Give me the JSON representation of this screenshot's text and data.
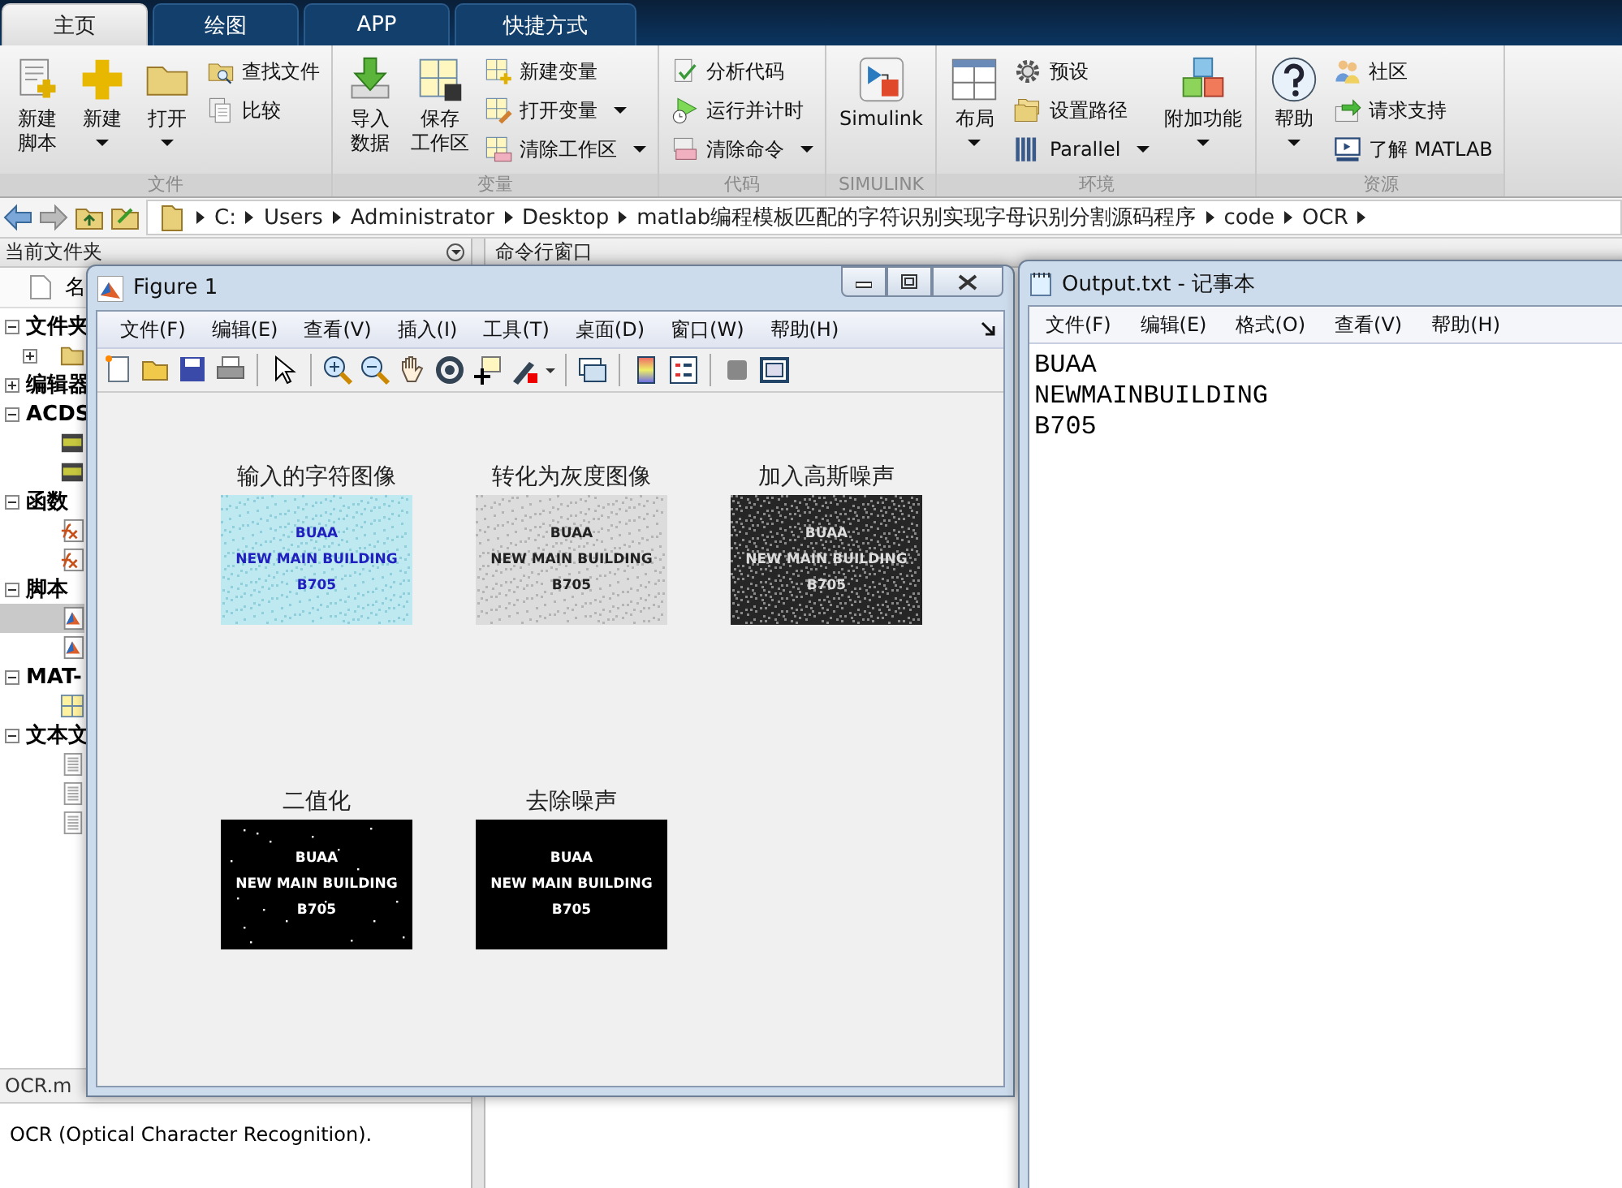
{
  "matlab": {
    "tabs": [
      {
        "label": "主页",
        "selected": true
      },
      {
        "label": "绘图",
        "selected": false
      },
      {
        "label": "APP",
        "selected": false
      },
      {
        "label": "快捷方式",
        "selected": false
      }
    ],
    "ribbon": [
      {
        "label": "文件",
        "columns": [
          {
            "kind": "large",
            "lines": [
              "新建",
              "脚本"
            ],
            "dropdown": false
          },
          {
            "kind": "large",
            "lines": [
              "新建"
            ],
            "dropdown": true
          },
          {
            "kind": "large",
            "lines": [
              "打开"
            ],
            "dropdown": true
          },
          {
            "kind": "stack",
            "items": [
              {
                "label": "查找文件",
                "dropdown": false
              },
              {
                "label": "比较",
                "dropdown": false
              }
            ]
          }
        ]
      },
      {
        "label": "变量",
        "columns": [
          {
            "kind": "large",
            "lines": [
              "导入",
              "数据"
            ],
            "dropdown": false
          },
          {
            "kind": "large",
            "lines": [
              "保存",
              "工作区"
            ],
            "dropdown": false
          },
          {
            "kind": "stack",
            "items": [
              {
                "label": "新建变量",
                "dropdown": false
              },
              {
                "label": "打开变量",
                "dropdown": true
              },
              {
                "label": "清除工作区",
                "dropdown": true
              }
            ]
          }
        ]
      },
      {
        "label": "代码",
        "columns": [
          {
            "kind": "stack",
            "items": [
              {
                "label": "分析代码",
                "dropdown": false
              },
              {
                "label": "运行并计时",
                "dropdown": false
              },
              {
                "label": "清除命令",
                "dropdown": true
              }
            ]
          }
        ]
      },
      {
        "label": "SIMULINK",
        "columns": [
          {
            "kind": "large",
            "lines": [
              "Simulink"
            ],
            "dropdown": false
          }
        ]
      },
      {
        "label": "环境",
        "columns": [
          {
            "kind": "large",
            "lines": [
              "布局"
            ],
            "dropdown": true
          },
          {
            "kind": "stack",
            "items": [
              {
                "label": "预设",
                "dropdown": false
              },
              {
                "label": "设置路径",
                "dropdown": false
              },
              {
                "label": "Parallel",
                "dropdown": true
              }
            ]
          },
          {
            "kind": "large",
            "lines": [
              "附加功能"
            ],
            "dropdown": true
          }
        ]
      },
      {
        "label": "资源",
        "columns": [
          {
            "kind": "large",
            "lines": [
              "帮助"
            ],
            "dropdown": true
          },
          {
            "kind": "stack",
            "items": [
              {
                "label": "社区",
                "dropdown": false
              },
              {
                "label": "请求支持",
                "dropdown": false
              },
              {
                "label": "了解 MATLAB",
                "dropdown": false
              }
            ]
          }
        ]
      }
    ],
    "address": [
      "C:",
      "Users",
      "Administrator",
      "Desktop",
      "matlab编程模板匹配的字符识别实现字母识别分割源码程序",
      "code",
      "OCR"
    ],
    "current_folder": {
      "title": "当前文件夹",
      "column": "名",
      "tree": [
        {
          "label": "文件夹",
          "expanded": true,
          "children": [
            {
              "kind": "folder",
              "expanded": false,
              "selected": false
            }
          ]
        },
        {
          "label": "编辑器",
          "expanded": false
        },
        {
          "label": "ACDS",
          "expanded": true,
          "children": [
            {
              "kind": "jpg",
              "selected": false
            },
            {
              "kind": "jpg",
              "selected": false
            }
          ]
        },
        {
          "label": "函数",
          "expanded": true,
          "children": [
            {
              "kind": "function",
              "selected": false
            },
            {
              "kind": "function",
              "selected": false
            }
          ]
        },
        {
          "label": "脚本",
          "expanded": true,
          "children": [
            {
              "kind": "script",
              "selected": true
            },
            {
              "kind": "script",
              "selected": false
            }
          ]
        },
        {
          "label": "MAT-",
          "expanded": true,
          "children": [
            {
              "kind": "mat",
              "selected": false
            }
          ]
        },
        {
          "label": "文本文",
          "expanded": true,
          "children": [
            {
              "kind": "text",
              "selected": false
            },
            {
              "kind": "text",
              "selected": false
            },
            {
              "kind": "text",
              "selected": false
            }
          ]
        }
      ],
      "file_name": "OCR.m",
      "description": "OCR (Optical Character Recognition)."
    },
    "command_window": {
      "title": "命令行窗口"
    }
  },
  "figure": {
    "title": "Figure 1",
    "menu": [
      "文件(F)",
      "编辑(E)",
      "查看(V)",
      "插入(I)",
      "工具(T)",
      "桌面(D)",
      "窗口(W)",
      "帮助(H)"
    ],
    "images": [
      {
        "title": "输入的字符图像",
        "kind": "color",
        "lines": [
          "BUAA",
          "NEW MAIN BUILDING",
          "B705"
        ]
      },
      {
        "title": "转化为灰度图像",
        "kind": "gray",
        "lines": [
          "BUAA",
          "NEW MAIN BUILDING",
          "B705"
        ]
      },
      {
        "title": "加入高斯噪声",
        "kind": "noisy",
        "lines": [
          "BUAA",
          "NEW MAIN BUILDING",
          "B705"
        ]
      },
      {
        "title": "二值化",
        "kind": "binary",
        "lines": [
          "BUAA",
          "NEW MAIN BUILDING",
          "B705"
        ]
      },
      {
        "title": "去除噪声",
        "kind": "clean",
        "lines": [
          "BUAA",
          "NEW MAIN BUILDING",
          "B705"
        ]
      }
    ]
  },
  "notepad": {
    "title": "Output.txt - 记事本",
    "menu": [
      "文件(F)",
      "编辑(E)",
      "格式(O)",
      "查看(V)",
      "帮助(H)"
    ],
    "lines": [
      "BUAA",
      "NEWMAINBUILDING",
      "B705"
    ]
  }
}
